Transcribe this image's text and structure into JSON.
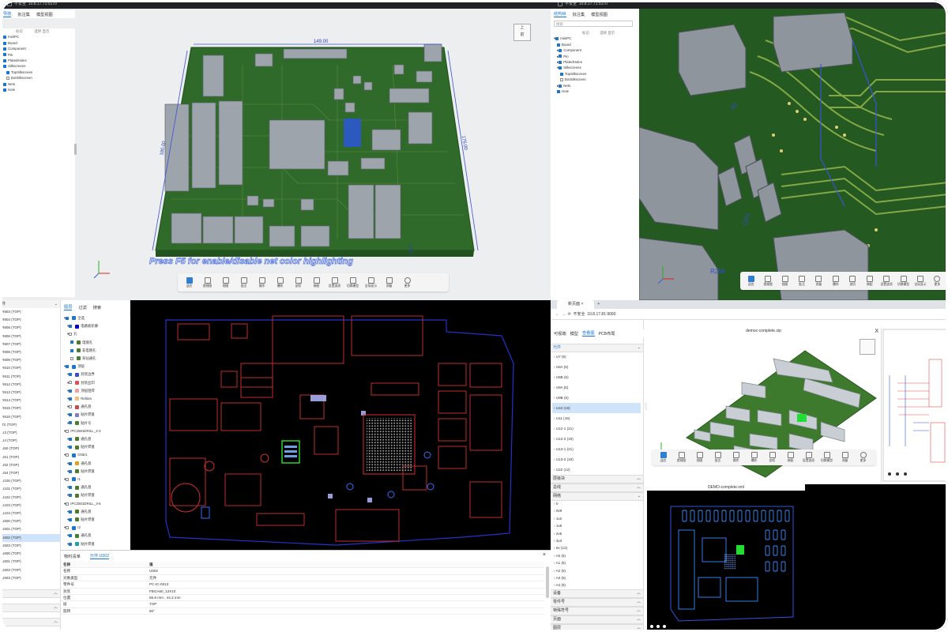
{
  "colors": {
    "board_green": "#2e6b2a",
    "dark_board": "#3f6f2f",
    "trace_green": "#8fb14a",
    "accent": "#1976d2",
    "silk_red": "#e02020",
    "silk_blue": "#3366ff",
    "bg_cad": "#000000"
  },
  "q1": {
    "browser": {
      "security": "不安全",
      "url": "10.8.17.71:5170"
    },
    "tabs": [
      "导航",
      "批注集",
      "模型视图"
    ],
    "tree_header": {
      "c1": "标记",
      "c2": "选择",
      "c3": "显示"
    },
    "tree": [
      "miniPC",
      "Board",
      "Component",
      "Pin",
      "PlatedHoles",
      "Silkscreens",
      "TopSilkscreen",
      "BotSilkscreen",
      "Nets",
      "Hole"
    ],
    "viewcube": {
      "top": "上",
      "front": "前"
    },
    "dimensions": {
      "top": "149.00",
      "left": "180.00",
      "right": "176.00",
      "small": "4.00"
    },
    "hint": "Press F5 for enable/disable net color highlighting",
    "toolbar": [
      "适应",
      "透视图",
      "视图",
      "批注",
      "操作",
      "爆炸",
      "剖切",
      "装配",
      "设置选项",
      "切换模型",
      "全局显示",
      "测量",
      "更多"
    ]
  },
  "q2": {
    "browser": {
      "security": "不安全",
      "url": "10.8.17.71:5170"
    },
    "tabs": [
      "结构树",
      "批注集",
      "模型视图"
    ],
    "search": "搜索",
    "tree_header": {
      "c1": "标记",
      "c2": "选择",
      "c3": "显示"
    },
    "tree": [
      "miniPC",
      "Board",
      "Component",
      "Pin",
      "PlatedHoles",
      "Silkscreens",
      "TopSilkscreen",
      "BotSilkscreen",
      "Nets",
      "Hole"
    ],
    "labels": {
      "a": "R2",
      "b": "R266",
      "c": "C201"
    },
    "toolbar": [
      "适应",
      "透视图",
      "视图",
      "批注",
      "测量",
      "爆炸",
      "剖切",
      "装配",
      "设置选项",
      "切换模型",
      "全局显示",
      "更多"
    ]
  },
  "q3": {
    "list": [
      "R803 (TOP)",
      "R804 (TOP)",
      "R805 (TOP)",
      "R806 (TOP)",
      "R807 (TOP)",
      "R808 (TOP)",
      "R809 (TOP)",
      "R810 (TOP)",
      "R811 (TOP)",
      "R812 (TOP)",
      "R813 (TOP)",
      "R814 (TOP)",
      "R815 (TOP)",
      "R816 (TOP)",
      "T2 (TOP)",
      "U3 (TOP)",
      "U4 (TOP)",
      "U50 (TOP)",
      "U51 (TOP)",
      "U52 (TOP)",
      "U54 (TOP)",
      "U100 (TOP)",
      "U101 (TOP)",
      "U102 (TOP)",
      "U103 (TOP)",
      "U104 (TOP)",
      "U500 (TOP)",
      "U501 (TOP)",
      "U502 (TOP)",
      "U503 (TOP)",
      "U600 (TOP)",
      "U601 (TOP)",
      "U602 (TOP)",
      "U603 (TOP)"
    ],
    "selected_index": 28,
    "list_header": "件",
    "bottom_sections": [
      "",
      "",
      ""
    ],
    "layer_tabs": [
      "图层",
      "过滤",
      "搜索"
    ],
    "layers": [
      {
        "name": "全选",
        "level": 0,
        "color": "#1976d2"
      },
      {
        "name": "电路板轮廓",
        "level": 1,
        "color": "#0000cc"
      },
      {
        "name": "孔",
        "level": 1,
        "color": ""
      },
      {
        "name": "电镀孔",
        "level": 2,
        "color": "#4a7c2e"
      },
      {
        "name": "非电镀孔",
        "level": 2,
        "color": "#4a7c2e"
      },
      {
        "name": "背钻通孔",
        "level": 2,
        "color": "#4a7c2e"
      },
      {
        "name": "顶层",
        "level": 0,
        "color": "#1976d2"
      },
      {
        "name": "封装边界",
        "level": 1,
        "color": "#3b4dd8"
      },
      {
        "name": "封装丝印",
        "level": 1,
        "color": "#e05050"
      },
      {
        "name": "顶层阻焊",
        "level": 1,
        "color": "#e8a0a0"
      },
      {
        "name": "Refdes",
        "level": 1,
        "color": "#f0c080"
      },
      {
        "name": "通孔盘",
        "level": 1,
        "color": "#c0504d"
      },
      {
        "name": "贴片焊盘",
        "level": 1,
        "color": "#8080c0"
      },
      {
        "name": "贴片号",
        "level": 1,
        "color": "#4a7c2e"
      },
      {
        "name": "IPC2581DRILL_2-3",
        "level": 0,
        "color": ""
      },
      {
        "name": "通孔盘",
        "level": 1,
        "color": "#4a7c2e"
      },
      {
        "name": "贴片焊盘",
        "level": 1,
        "color": "#4a7c2e"
      },
      {
        "name": "GND1",
        "level": 0,
        "color": "#1976d2"
      },
      {
        "name": "通孔盘",
        "level": 1,
        "color": "#e0a020"
      },
      {
        "name": "贴片焊盘",
        "level": 1,
        "color": "#4a7c2e"
      },
      {
        "name": "I1",
        "level": 0,
        "color": "#1976d2"
      },
      {
        "name": "通孔盘",
        "level": 1,
        "color": "#4a7c2e"
      },
      {
        "name": "贴片焊盘",
        "level": 1,
        "color": "#4a7c2e"
      },
      {
        "name": "IPC2581DRILL_3-6",
        "level": 0,
        "color": ""
      },
      {
        "name": "通孔盘",
        "level": 1,
        "color": "#4a7c2e"
      },
      {
        "name": "贴片焊盘",
        "level": 1,
        "color": "#4a7c2e"
      },
      {
        "name": "I2",
        "level": 0,
        "color": "#1976d2"
      },
      {
        "name": "通孔盘",
        "level": 1,
        "color": "#4a7c2e"
      },
      {
        "name": "贴片焊盘",
        "level": 1,
        "color": "#20a0a0"
      }
    ],
    "prop_tabs": [
      "物料清单",
      "元件:U502"
    ],
    "prop_header": {
      "k": "名称",
      "v": "值"
    },
    "props": [
      [
        "名称",
        "U502"
      ],
      [
        "对象类型",
        "元件"
      ],
      [
        "零件号",
        "PC-IC-0013"
      ],
      [
        "封装",
        "FBGA60_12X10"
      ],
      [
        "位置",
        "65.8 mm , 44.2 mm"
      ],
      [
        "层",
        "TOP"
      ],
      [
        "旋转",
        "90°"
      ]
    ]
  },
  "q4": {
    "tab_title": "新页面",
    "url": "10.8.17.81:9090",
    "security": "不安全",
    "tabs": [
      "可视端",
      "模型",
      "查看图",
      "PCB布局"
    ],
    "section_top": "元件",
    "parts": [
      "U7 (5)",
      "U8A (5)",
      "U8B (5)",
      "U9A (5)",
      "U9B (5)",
      "U10 (16)",
      "U11 (16)",
      "U12-1 (21)",
      "U12-2 (19)",
      "U13-1 (21)",
      "U13-2 (19)",
      "U22 (12)"
    ],
    "selected_part": 5,
    "sections_mid": [
      "层级块",
      "总线",
      "网络"
    ],
    "nets": [
      "0",
      "0v9",
      "1v2",
      "1v8",
      "2v5",
      "3v3",
      "5v (13)",
      "A0 (5)",
      "A1 (5)",
      "A2 (5)",
      "A3 (5)",
      "A4 (5)"
    ],
    "sections_bot": [
      "设备",
      "零件号",
      "特殊符号",
      "页面",
      "图层"
    ],
    "model_title": "democ-complete.zip",
    "layout_title": "DEMO-complete.xml",
    "toolbar": [
      "适应",
      "透视图",
      "视图",
      "批注",
      "操作",
      "爆炸",
      "剖切",
      "装配",
      "设置选项",
      "切换模型",
      "测量",
      "更多"
    ],
    "close": "X"
  }
}
